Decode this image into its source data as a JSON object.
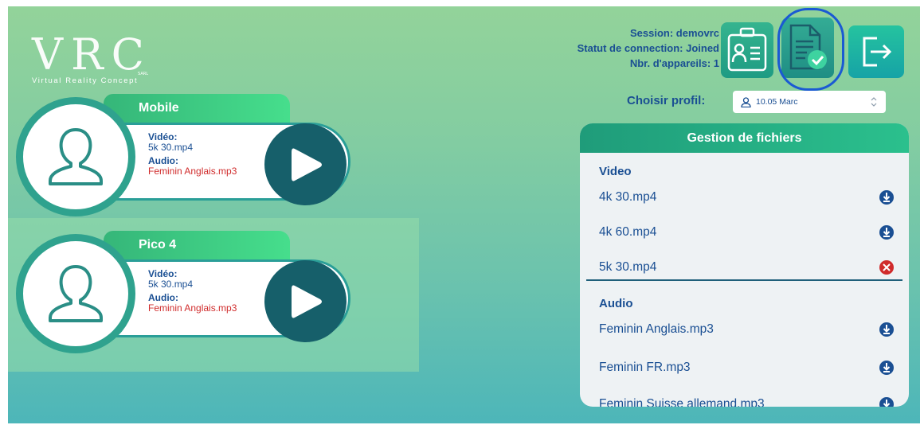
{
  "logo": {
    "mark": "VRC",
    "tagline": "Virtual Reality Concept",
    "suffix": "SARL"
  },
  "session": {
    "name_line": "Session: demovrc",
    "status_line": "Statut de connection: Joined",
    "devices_line": "Nbr. d'appareils: 1"
  },
  "toolbar": {
    "profile_button_icon": "id-card-icon",
    "files_button_icon": "document-check-icon",
    "exit_button_icon": "exit-icon"
  },
  "profile_chooser": {
    "label": "Choisir profil:",
    "selected": "10.05 Marc"
  },
  "devices": [
    {
      "name": "Mobile",
      "video_label": "Vidéo:",
      "video": "5k 30.mp4",
      "audio_label": "Audio:",
      "audio": "Feminin Anglais.mp3"
    },
    {
      "name": "Pico 4",
      "video_label": "Vidéo:",
      "video": "5k 30.mp4",
      "audio_label": "Audio:",
      "audio": "Feminin Anglais.mp3"
    }
  ],
  "file_panel": {
    "title": "Gestion de fichiers",
    "video": {
      "title": "Video",
      "files": [
        "4k 30.mp4",
        "4k 60.mp4",
        "5k 30.mp4"
      ]
    },
    "audio": {
      "title": "Audio",
      "files": [
        "Feminin Anglais.mp3",
        "Feminin FR.mp3",
        "Feminin Suisse allemand.mp3"
      ]
    }
  },
  "colors": {
    "accent_green": "#2fa28e",
    "text_blue": "#1a4f93",
    "play_dark": "#165f6a",
    "delete_red": "#d02b2b"
  }
}
